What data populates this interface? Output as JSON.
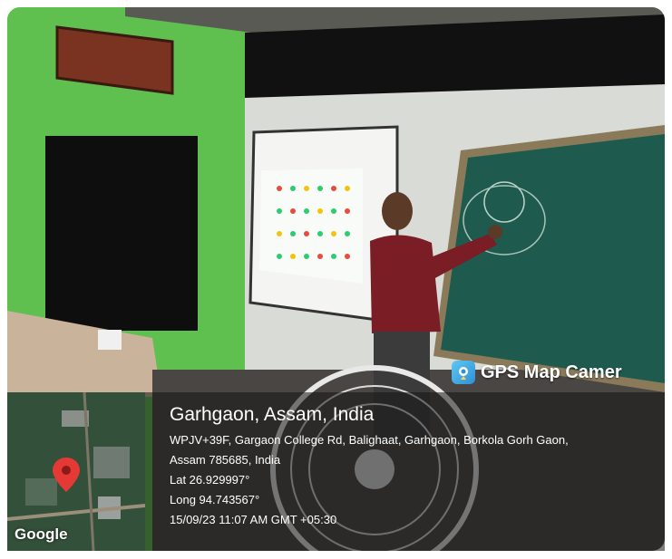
{
  "gps_badge": {
    "label": "GPS Map Camer",
    "icon": "gps-camera-icon",
    "accent": "#2f8fd6"
  },
  "location": {
    "place": "Garhgaon, Assam, India",
    "address_line1": "WPJV+39F, Gargaon College Rd, Balighaat, Garhgaon, Borkola Gorh Gaon,",
    "address_line2": "Assam 785685, India",
    "lat": "Lat 26.929997°",
    "long": "Long 94.743567°",
    "timestamp": "15/09/23 11:07 AM GMT +05:30"
  },
  "map": {
    "logo": "Google",
    "pin_color": "#e53935",
    "pin_icon": "map-pin-icon"
  },
  "colors": {
    "wall_green": "#5fbf4f",
    "board_green": "#1f5a4e",
    "shirt": "#7a1d24"
  }
}
